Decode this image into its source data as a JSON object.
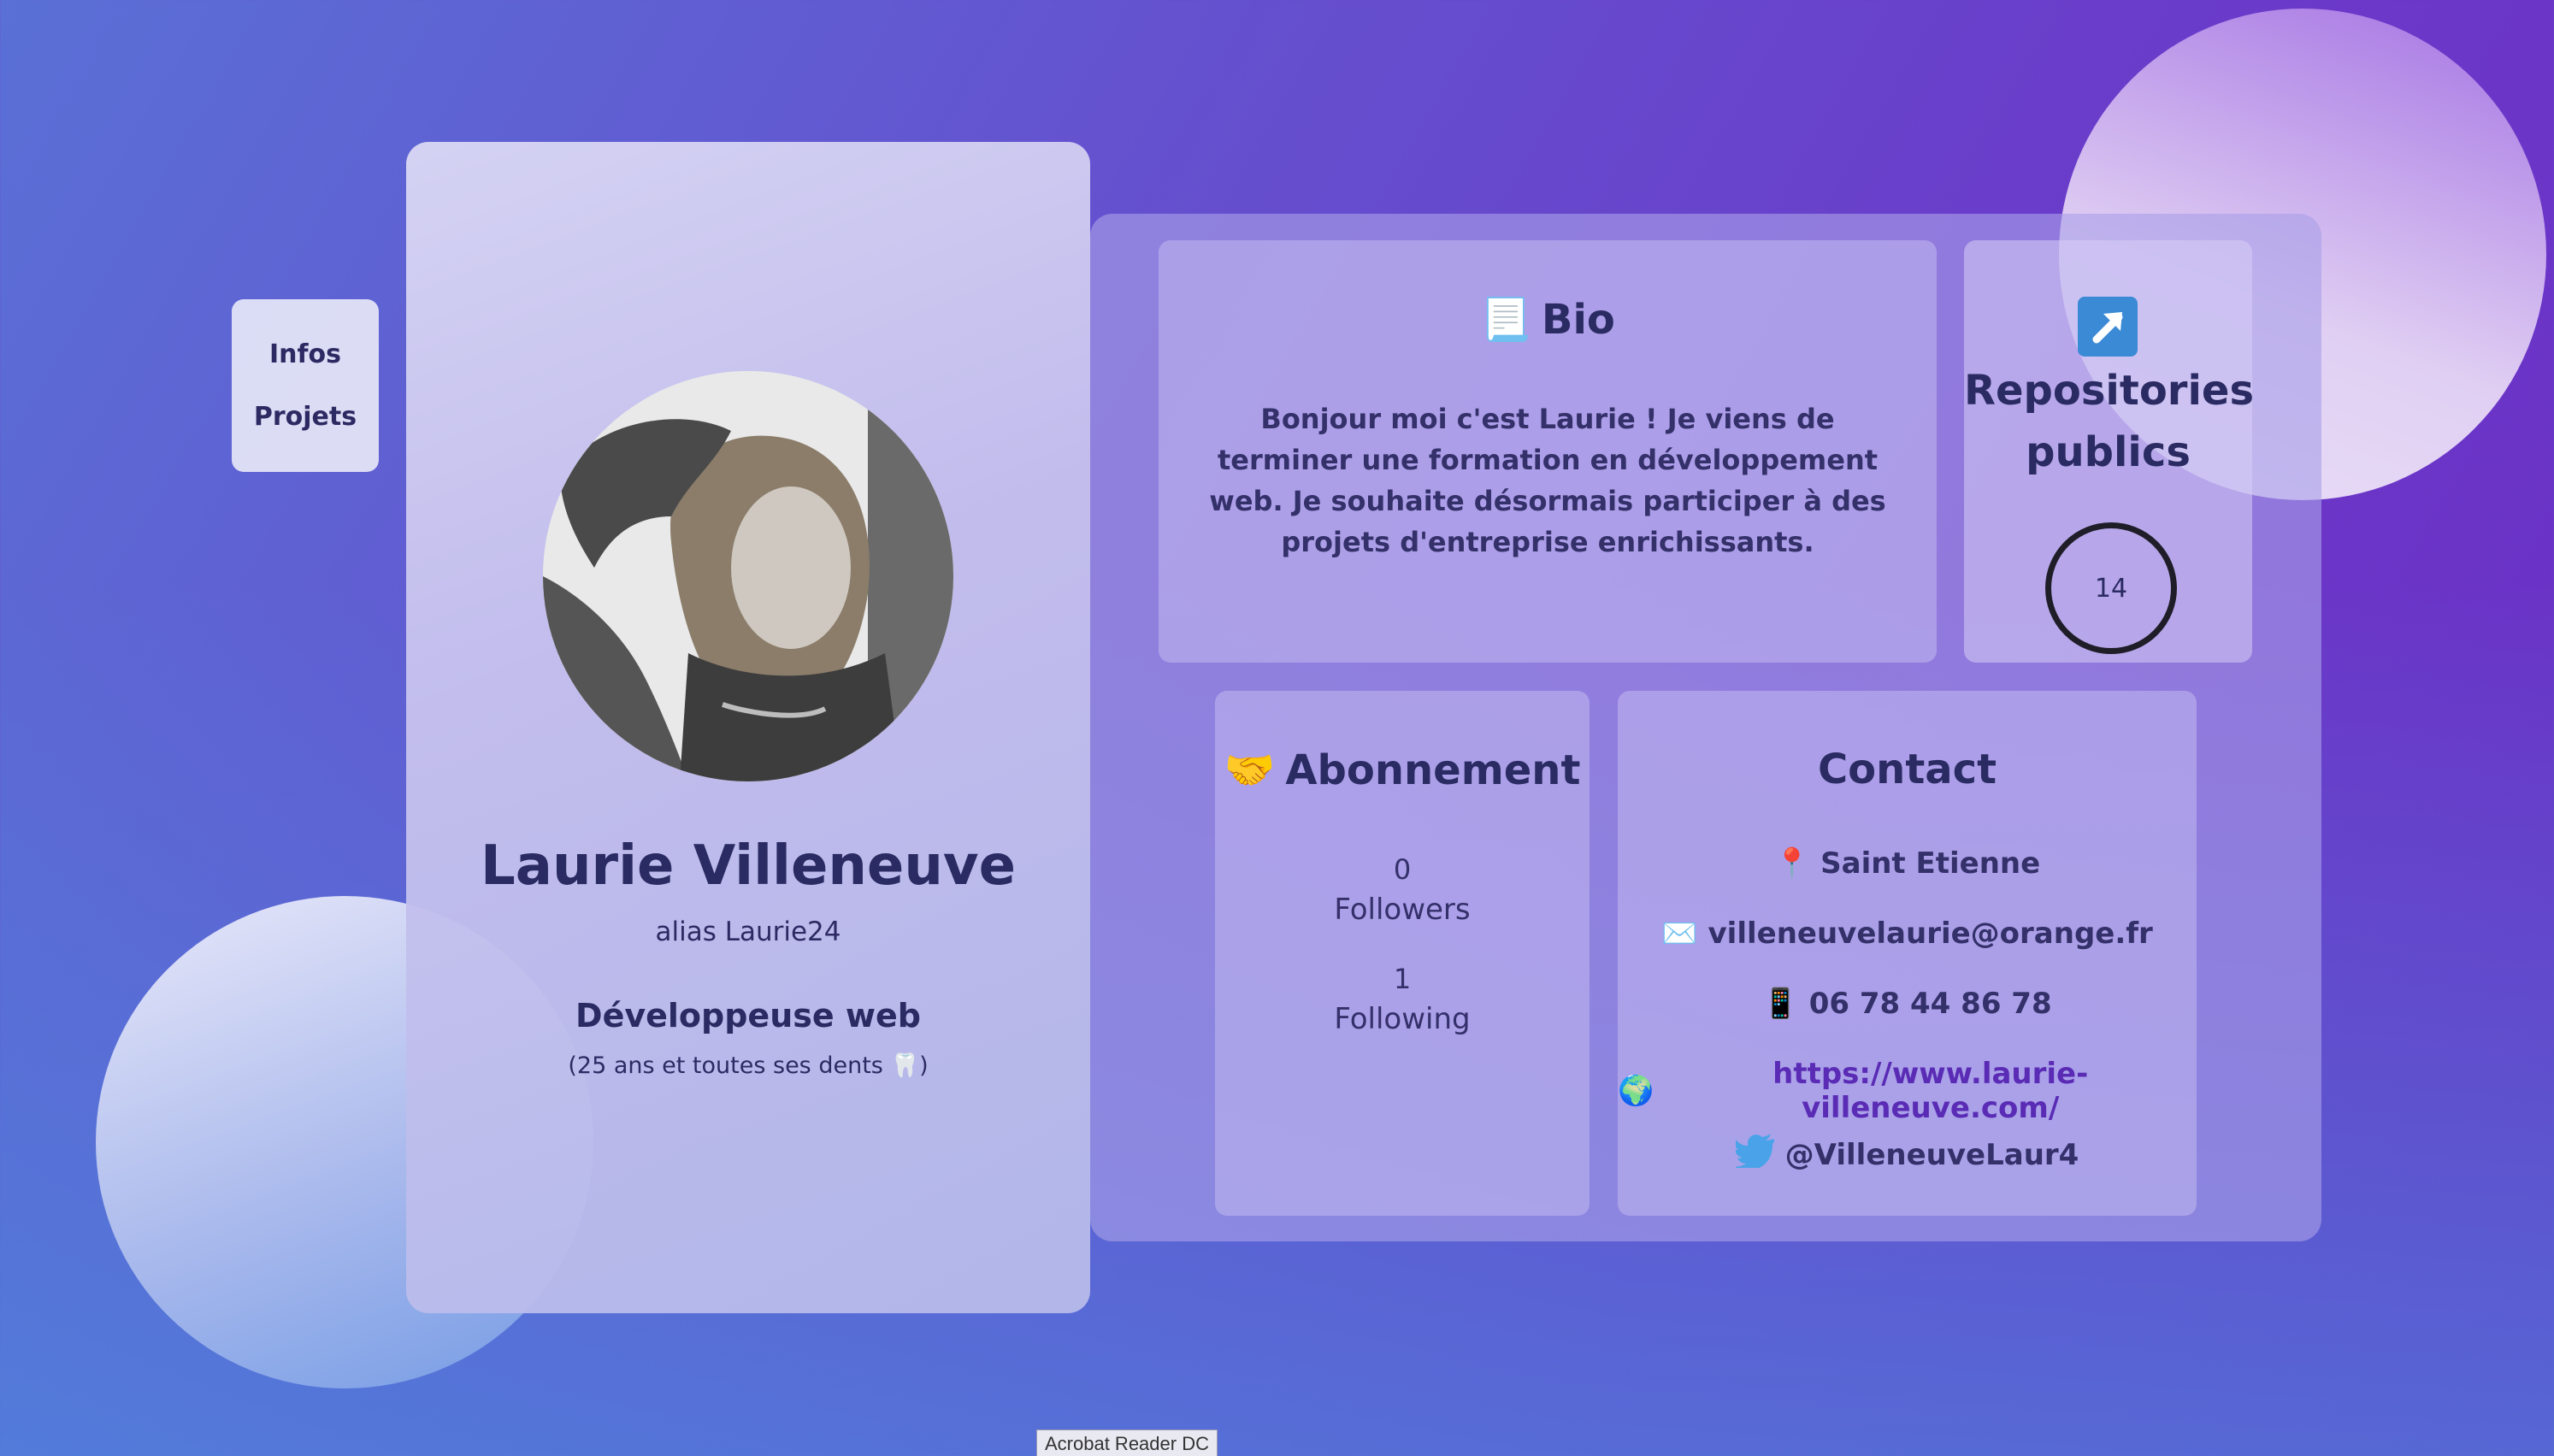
{
  "nav": {
    "items": [
      {
        "label": "Infos"
      },
      {
        "label": "Projets"
      }
    ]
  },
  "profile": {
    "name": "Laurie Villeneuve",
    "alias": "alias Laurie24",
    "role": "Développeuse web",
    "age_prefix": "(25 ans et toutes ses dents ",
    "age_suffix": ")"
  },
  "bio": {
    "title": "Bio",
    "icon": "scroll-icon",
    "text": "Bonjour moi c'est Laurie ! Je viens de terminer une formation en développement web. Je souhaite désormais participer à des projets d'entreprise enrichissants."
  },
  "repos": {
    "title_line1": "Repositories",
    "title_line2": "publics",
    "icon": "arrow-up-right-icon",
    "count": "14"
  },
  "subscriptions": {
    "title": "Abonnement",
    "icon": "handshake-icon",
    "followers_count": "0",
    "followers_label": "Followers",
    "following_count": "1",
    "following_label": "Following"
  },
  "contact": {
    "title": "Contact",
    "location": "Saint Etienne",
    "email": "villeneuvelaurie@orange.fr",
    "phone": "06 78 44 86 78",
    "website": "https://www.laurie-villeneuve.com/",
    "twitter": "@VilleneuveLaur4"
  },
  "taskbar": {
    "tooltip": "Acrobat Reader DC"
  },
  "colors": {
    "accent_text": "#2b2b63",
    "link": "#5a2bb5",
    "background_start": "#5a70d6",
    "background_end": "#6a2ec4"
  }
}
